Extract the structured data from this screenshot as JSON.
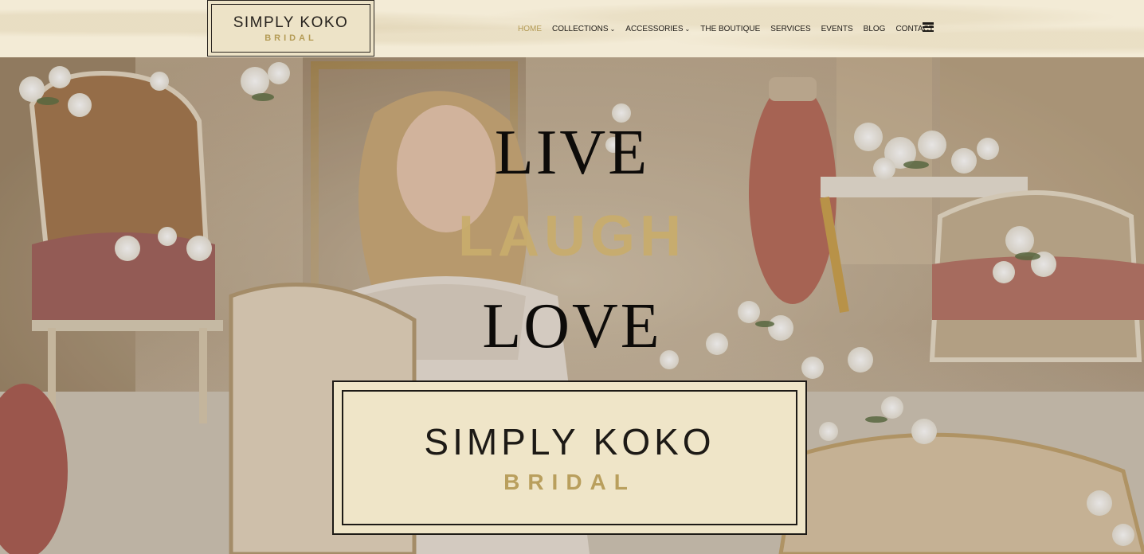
{
  "header": {
    "logo": {
      "brand": "SIMPLY KOKO",
      "sub": "BRIDAL"
    },
    "nav": [
      {
        "label": "HOME",
        "active": true,
        "dropdown": false
      },
      {
        "label": "COLLECTIONS",
        "active": false,
        "dropdown": true
      },
      {
        "label": "ACCESSORIES",
        "active": false,
        "dropdown": true
      },
      {
        "label": "THE BOUTIQUE",
        "active": false,
        "dropdown": false
      },
      {
        "label": "SERVICES",
        "active": false,
        "dropdown": false
      },
      {
        "label": "EVENTS",
        "active": false,
        "dropdown": false
      },
      {
        "label": "BLOG",
        "active": false,
        "dropdown": false
      },
      {
        "label": "CONTACT",
        "active": false,
        "dropdown": false
      }
    ],
    "menu_icon": "hamburger-menu-icon"
  },
  "hero": {
    "line1": "LIVE",
    "line2": "LAUGH",
    "line3": "LOVE",
    "logo": {
      "brand": "SIMPLY KOKO",
      "sub": "BRIDAL"
    }
  },
  "colors": {
    "accent_gold": "#b49b55",
    "header_bg": "#f3ebd6",
    "text_dark": "#1e1b17"
  }
}
